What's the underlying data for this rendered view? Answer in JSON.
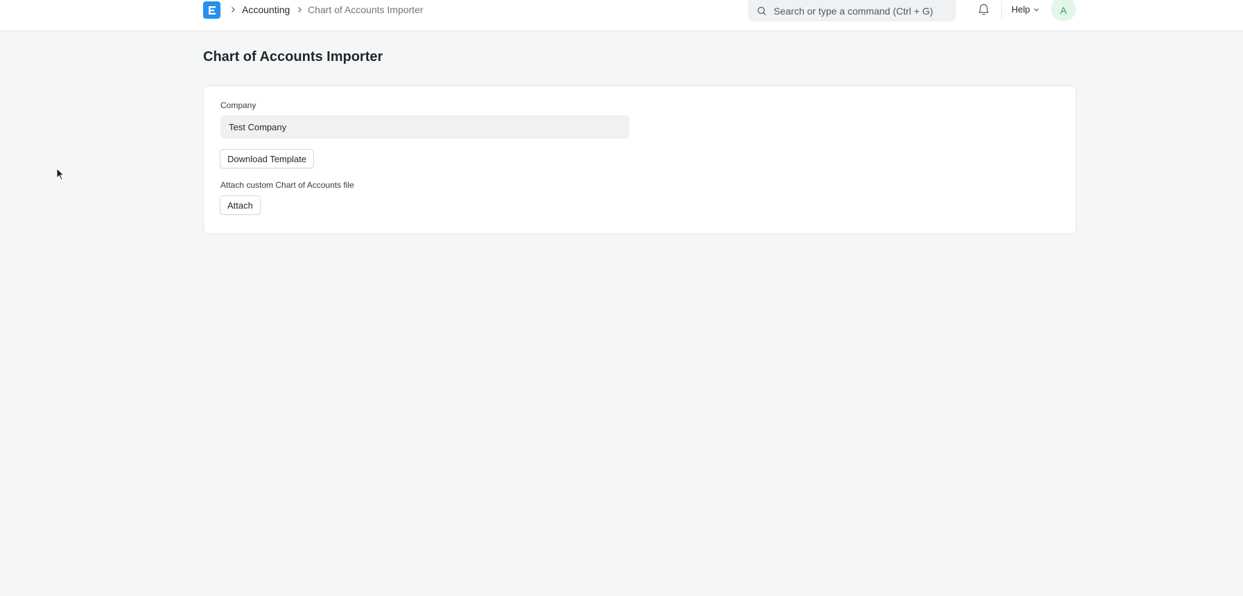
{
  "navbar": {
    "logo_letter": "E",
    "breadcrumbs": [
      {
        "label": "Accounting"
      },
      {
        "label": "Chart of Accounts Importer"
      }
    ],
    "search_placeholder": "Search or type a command (Ctrl + G)",
    "help_label": "Help",
    "avatar_initial": "A"
  },
  "page": {
    "title": "Chart of Accounts Importer"
  },
  "form": {
    "company_label": "Company",
    "company_value": "Test Company",
    "download_button": "Download Template",
    "attach_label": "Attach custom Chart of Accounts file",
    "attach_button": "Attach"
  },
  "colors": {
    "brand": "#2490ef",
    "background": "#f5f7f7",
    "avatar_bg": "#e4f5e9",
    "avatar_text": "#2e9e48"
  },
  "icons": [
    "app-logo-icon",
    "chevron-right-icon",
    "search-icon",
    "bell-icon",
    "chevron-down-icon",
    "mouse-pointer-icon"
  ]
}
